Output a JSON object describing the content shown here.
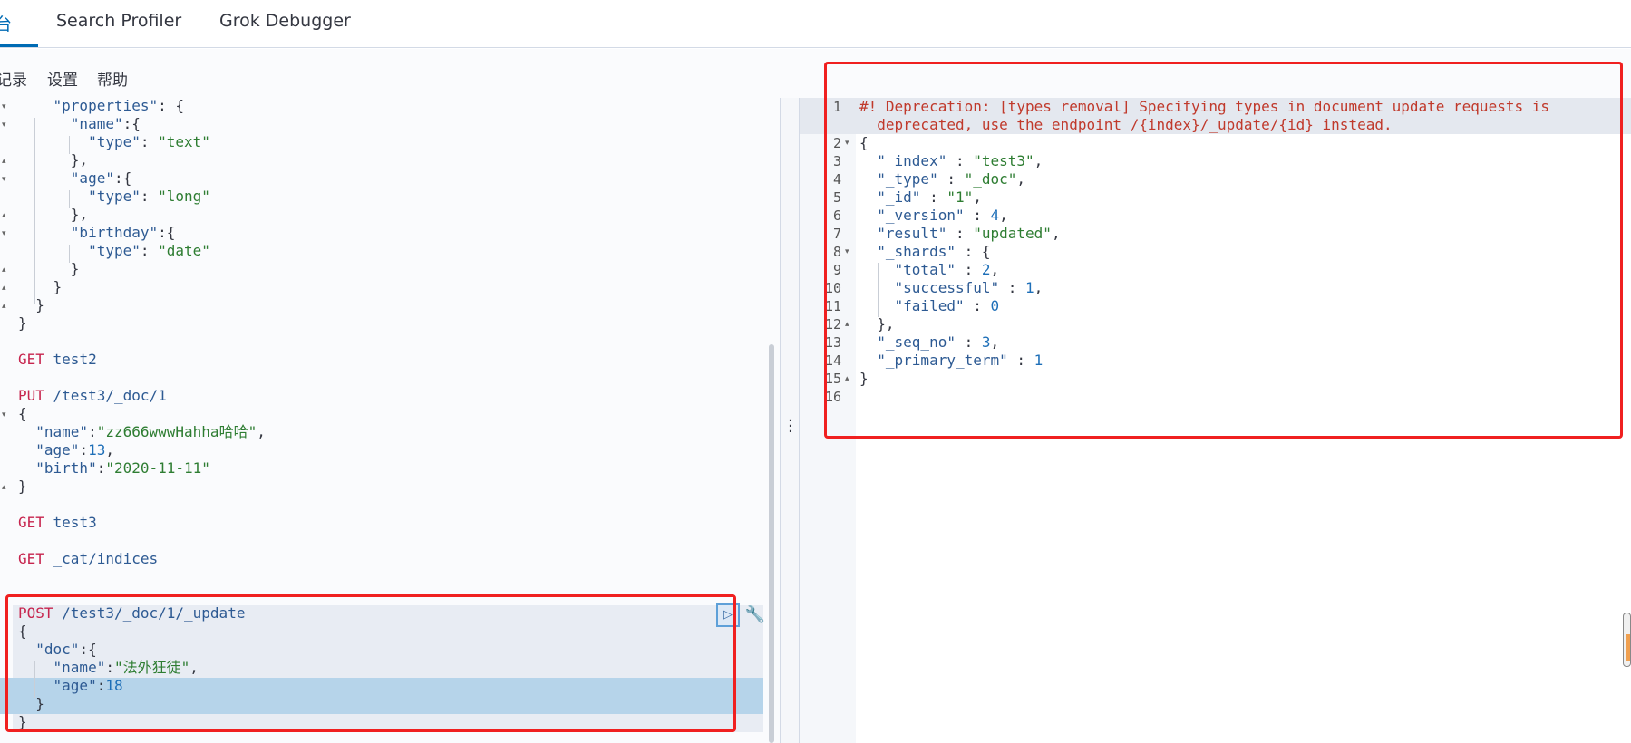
{
  "tabs": [
    {
      "label": "台",
      "active": true
    },
    {
      "label": "Search Profiler",
      "active": false
    },
    {
      "label": "Grok Debugger",
      "active": false
    }
  ],
  "menu": [
    "记录",
    "设置",
    "帮助"
  ],
  "request_editor": {
    "lines": [
      "    \"properties\": {",
      "      \"name\":{",
      "        \"type\": \"text\"",
      "      },",
      "      \"age\":{",
      "        \"type\": \"long\"",
      "      },",
      "      \"birthday\":{",
      "        \"type\": \"date\"",
      "      }",
      "    }",
      "  }",
      "}",
      "",
      "GET test2",
      "",
      "PUT /test3/_doc/1",
      "{",
      "  \"name\":\"zz666wwwHahha哈哈\",",
      "  \"age\":13,",
      "  \"birth\":\"2020-11-11\"",
      "}",
      "",
      "GET test3",
      "",
      "GET _cat/indices",
      "",
      "",
      "POST /test3/_doc/1/_update",
      "{",
      "  \"doc\":{",
      "    \"name\":\"法外狂徒\",",
      "    \"age\":18",
      "  }",
      "}"
    ]
  },
  "response": {
    "line_numbers": [
      "1",
      "",
      "2",
      "3",
      "4",
      "5",
      "6",
      "7",
      "8",
      "9",
      "10",
      "11",
      "12",
      "13",
      "14",
      "15",
      "16"
    ],
    "warning_line1": "#! Deprecation: [types removal] Specifying types in document update requests is",
    "warning_line2": "  deprecated, use the endpoint /{index}/_update/{id} instead.",
    "body": [
      "{",
      "  \"_index\" : \"test3\",",
      "  \"_type\" : \"_doc\",",
      "  \"_id\" : \"1\",",
      "  \"_version\" : 4,",
      "  \"result\" : \"updated\",",
      "  \"_shards\" : {",
      "    \"total\" : 2,",
      "    \"successful\" : 1,",
      "    \"failed\" : 0",
      "  },",
      "  \"_seq_no\" : 3,",
      "  \"_primary_term\" : 1",
      "}",
      ""
    ]
  },
  "icons": {
    "run": "play-icon",
    "settings": "wrench-icon",
    "splitter": "vertical-dots-icon"
  },
  "colors": {
    "accent": "#006bb4",
    "method": "#c7254e",
    "string": "#2e7d32",
    "number": "#1e6fb8",
    "warning": "#c0392b",
    "highlight_box": "#f02020"
  }
}
